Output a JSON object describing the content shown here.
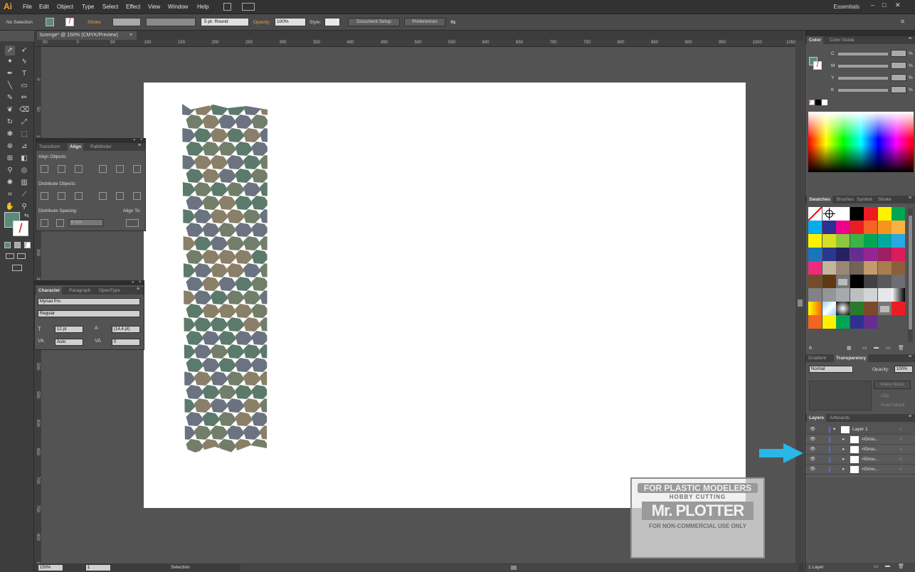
{
  "app": {
    "logo": "Ai"
  },
  "menu": [
    "File",
    "Edit",
    "Object",
    "Type",
    "Select",
    "Effect",
    "View",
    "Window",
    "Help"
  ],
  "workspace": {
    "label": "Essentials"
  },
  "control_bar": {
    "selection_label": "No Selection",
    "stroke_label": "Stroke",
    "brush_label": "5 pt. Round",
    "opacity_label": "Opacity:",
    "opacity_value": "100%",
    "style_label": "Style:",
    "document_setup": "Document Setup",
    "preferences": "Preferences"
  },
  "document": {
    "tab_title": "lozenge* @ 150% (CMYK/Preview)"
  },
  "ruler_h_ticks": [
    "50",
    "0",
    "50",
    "100",
    "150",
    "200",
    "250",
    "300",
    "350",
    "400",
    "450",
    "500",
    "550",
    "600",
    "650",
    "700",
    "750",
    "800",
    "850",
    "900",
    "950",
    "1000",
    "1050"
  ],
  "ruler_v_ticks": [
    "0",
    "50",
    "100",
    "150",
    "200",
    "250",
    "300",
    "350",
    "400",
    "450",
    "500",
    "550",
    "600",
    "650",
    "700",
    "750",
    "800",
    "850"
  ],
  "align_panel": {
    "tabs": [
      "Transform",
      "Align",
      "Pathfinder"
    ],
    "align_objects": "Align Objects:",
    "distribute_objects": "Distribute Objects:",
    "distribute_spacing": "Distribute Spacing:",
    "align_to": "Align To:",
    "spacing_value": "6 mm"
  },
  "character_panel": {
    "tabs": [
      "Character",
      "Paragraph",
      "OpenType"
    ],
    "font_family": "Myriad Pro",
    "font_style": "Regular",
    "font_size": "12 pt",
    "leading": "(14,4 pt)",
    "kerning": "Auto",
    "tracking": "0"
  },
  "color_panel": {
    "tabs": [
      "Color",
      "Color Guide"
    ],
    "channels": [
      "C",
      "M",
      "Y",
      "K"
    ],
    "unit": "%"
  },
  "swatches_panel": {
    "tabs": [
      "Swatches",
      "Brushes",
      "Symbol",
      "Stroke"
    ],
    "colors": [
      "#ffffff",
      "#000000",
      "#ed1c24",
      "#fff200",
      "#00a651",
      "#00aeef",
      "#2e3192",
      "#ec008c",
      "#ed1c24",
      "#f26522",
      "#f7941d",
      "#fbb040",
      "#fff200",
      "#d7df23",
      "#8dc63f",
      "#39b54a",
      "#00a651",
      "#00a99d",
      "#27aae1",
      "#1c75bc",
      "#2b388f",
      "#262262",
      "#662d91",
      "#92278f",
      "#9e1f63",
      "#da1c5c",
      "#ee2a7b",
      "#c2b59b",
      "#998675",
      "#736357",
      "#c49a6c",
      "#a97c50",
      "#8b5e3c",
      "#754c29",
      "#603913",
      "#000000",
      "#414042",
      "#58595b",
      "#6d6e71",
      "#808285",
      "#939598",
      "#a7a9ac",
      "#bcbec0",
      "#d1d3d4",
      "#e6e7e8",
      "#ed1c24",
      "#f26522",
      "#fff200",
      "#00a651",
      "#2e3192",
      "#662d91"
    ]
  },
  "transparency_panel": {
    "tabs": [
      "Gradient",
      "Transparency"
    ],
    "mode": "Normal",
    "opacity_label": "Opacity:",
    "opacity_value": "100%",
    "make_mask": "Make Mask",
    "clip": "Clip",
    "invert_mask": "Invert Mask"
  },
  "layers_panel": {
    "tabs": [
      "Layers",
      "Artboards"
    ],
    "layers": [
      {
        "name": "Layer 1"
      },
      {
        "name": "<Grou..."
      },
      {
        "name": "<Grou..."
      },
      {
        "name": "<Grou..."
      },
      {
        "name": "<Grou..."
      }
    ],
    "count_label": "1 Layer"
  },
  "status_bar": {
    "zoom": "150%",
    "artboard_number": "1",
    "tool": "Selection"
  },
  "watermark": {
    "line1": "FOR PLASTIC MODELERS",
    "line2": "HOBBY CUTTING",
    "line3": "Mr. PLOTTER",
    "line4": "FOR NON-COMMERCIAL USE ONLY"
  },
  "pattern_colors": [
    "#5c7a6b",
    "#6b7280",
    "#8a7f68",
    "#727e6a"
  ],
  "accent_arrow_color": "#29b6e8"
}
